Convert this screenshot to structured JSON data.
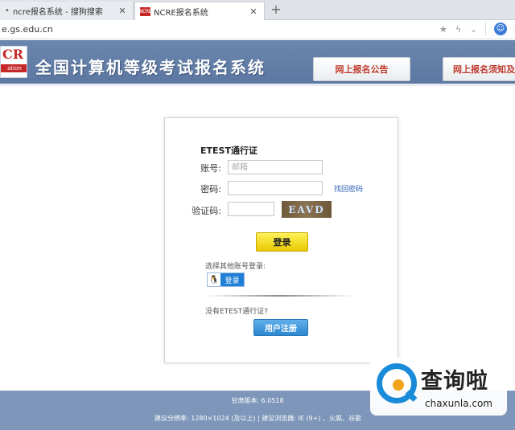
{
  "browser": {
    "tabs": [
      {
        "title": "ncre报名系统 - 搜狗搜索",
        "close": "✕"
      },
      {
        "title": "NCRE报名系统",
        "close": "✕",
        "favicon": "NCRE"
      }
    ],
    "new_tab": "+",
    "url": "e.gs.edu.cn"
  },
  "header": {
    "logo_letters": "CR",
    "logo_sub": "ation",
    "title": "全国计算机等级考试报名系统",
    "buttons": [
      {
        "label": "网上报名公告"
      },
      {
        "label": "网上报名须知及"
      }
    ]
  },
  "login": {
    "title": "ETEST通行证",
    "account_label": "账号:",
    "account_placeholder": "邮箱",
    "password_label": "密码:",
    "forgot_link": "找回密码",
    "captcha_label": "验证码:",
    "captcha_text": "EAVD",
    "login_button": "登录",
    "other_login_text": "选择其他账号登录:",
    "qq_login_label": "登录",
    "no_account_text": "没有ETEST通行证?",
    "register_button": "用户注册"
  },
  "footer": {
    "version": "甘肃版本: 6.0518",
    "recommendation": "建议分辨率: 1280×1024 (及以上)  |  建议浏览器: IE (9+) 、火狐、谷歌"
  },
  "watermark": {
    "chinese": "查询啦",
    "pinyin": "chaxunla.com"
  },
  "colors": {
    "header_bg": "#5c77a1",
    "footer_bg": "#7d96b9",
    "login_button": "#f2da1a",
    "register_button": "#2e86cf",
    "link": "#2a5db0"
  }
}
